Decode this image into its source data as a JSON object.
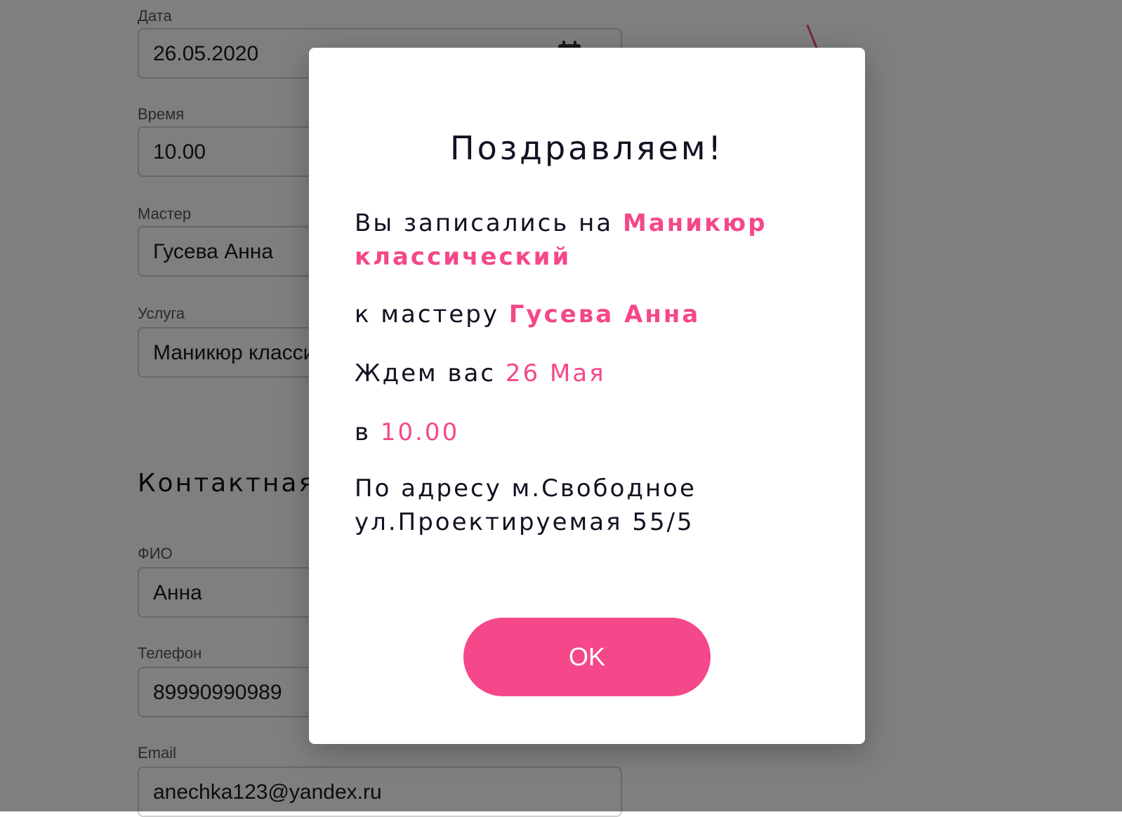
{
  "form": {
    "date": {
      "label": "Дата",
      "value": "26.05.2020"
    },
    "time": {
      "label": "Время",
      "value": "10.00"
    },
    "master": {
      "label": "Мастер",
      "value": "Гусева Анна"
    },
    "service": {
      "label": "Услуга",
      "value": "Маникюр классический"
    },
    "contact_section_title": "Контактная",
    "name": {
      "label": "ФИО",
      "value": "Анна"
    },
    "phone": {
      "label": "Телефон",
      "value": "89990990989"
    },
    "email": {
      "label": "Email",
      "value": "anechka123@yandex.ru"
    }
  },
  "icons": {
    "date_field": "calendar-icon"
  },
  "modal": {
    "title": "Поздравляем!",
    "line1_prefix": "Вы записались на",
    "line1_service": "Маникюр классический",
    "line2_prefix": "к мастеру",
    "line2_master": "Гусева Анна",
    "line3_prefix": "Ждем вас",
    "line3_date": "26 Мая",
    "line4_prefix": "в",
    "line4_time": "10.00",
    "address": "По адресу м.Свободное ул.Проектируемая 55/5",
    "ok_label": "OK"
  },
  "colors": {
    "accent": "#f4488a",
    "overlay": "rgba(0,0,0,0.5)",
    "text": "#111122"
  }
}
